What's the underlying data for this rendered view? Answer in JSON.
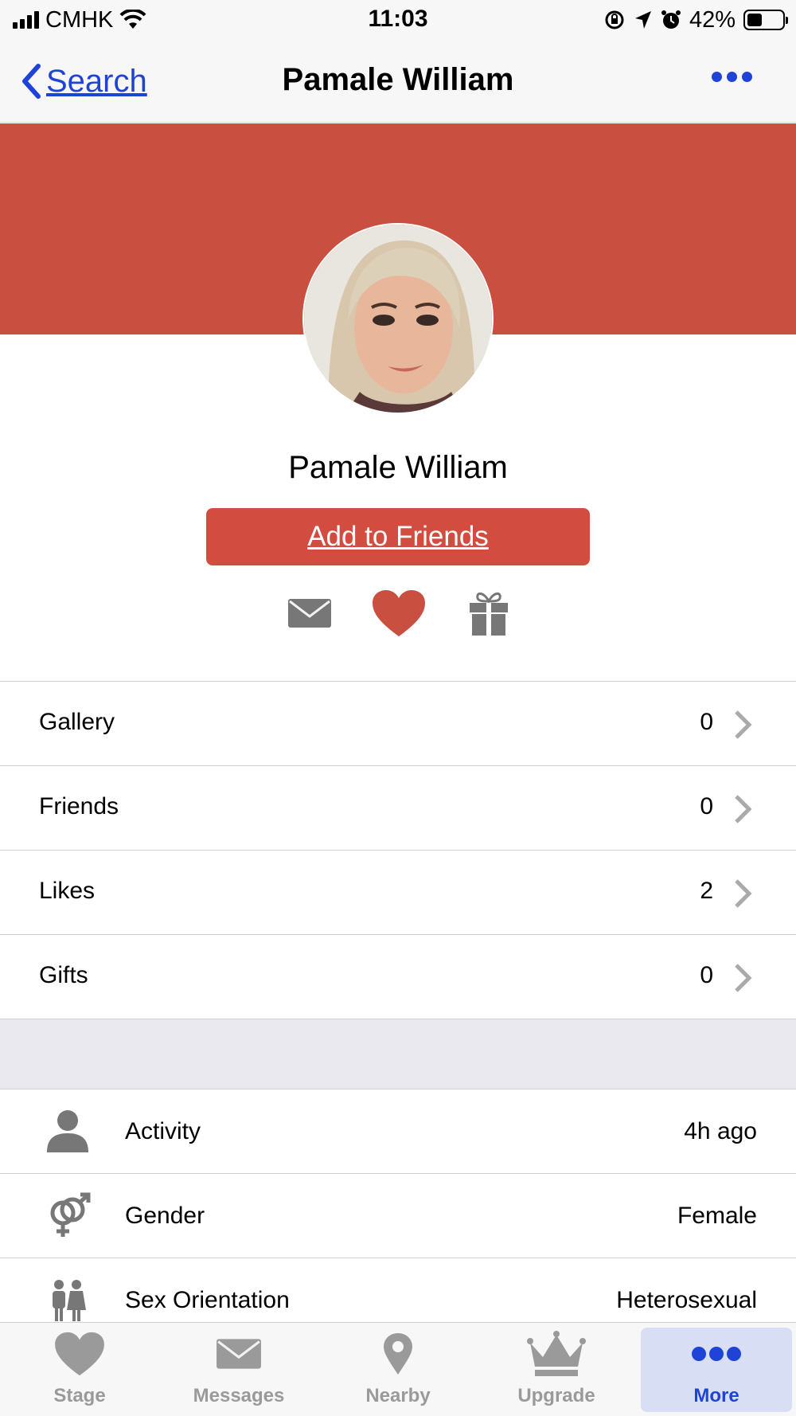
{
  "status_bar": {
    "carrier": "CMHK",
    "time": "11:03",
    "battery_percent": "42%",
    "battery_level": 0.42
  },
  "nav": {
    "back_label": "Search",
    "title": "Pamale William",
    "accent_color": "#1f43d6"
  },
  "profile": {
    "banner_color": "#c94f40",
    "name": "Pamale William",
    "add_friends_label": "Add to Friends",
    "action_icons": [
      "envelope-icon",
      "heart-icon",
      "gift-icon"
    ]
  },
  "stats": [
    {
      "label": "Gallery",
      "value": "0"
    },
    {
      "label": "Friends",
      "value": "0"
    },
    {
      "label": "Likes",
      "value": "2"
    },
    {
      "label": "Gifts",
      "value": "0"
    }
  ],
  "info": [
    {
      "icon": "person-icon",
      "label": "Activity",
      "value": "4h ago"
    },
    {
      "icon": "gender-icon",
      "label": "Gender",
      "value": "Female"
    },
    {
      "icon": "couple-icon",
      "label": "Sex Orientation",
      "value": "Heterosexual"
    }
  ],
  "tabs": [
    {
      "icon": "heart-icon",
      "label": "Stage",
      "active": false
    },
    {
      "icon": "envelope-icon",
      "label": "Messages",
      "active": false
    },
    {
      "icon": "location-pin-icon",
      "label": "Nearby",
      "active": false
    },
    {
      "icon": "crown-icon",
      "label": "Upgrade",
      "active": false
    },
    {
      "icon": "more-dots-icon",
      "label": "More",
      "active": true
    }
  ]
}
